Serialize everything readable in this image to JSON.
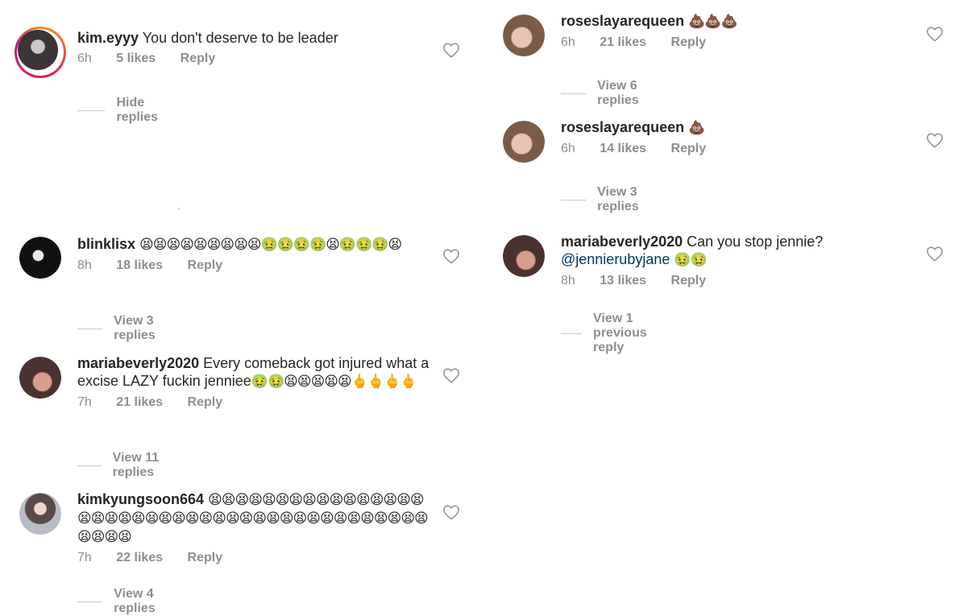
{
  "left_column": [
    {
      "username": "kim.eyyy",
      "text": "You don't deserve to be leader",
      "emojis": "",
      "time": "6h",
      "likes": "5 likes",
      "reply": "Reply",
      "replies_link": "Hide replies",
      "avatar_color": "#2e2a2c"
    },
    {
      "username": "blinklisx",
      "text": "",
      "emojis": "😫😫😫😫😫😫😫😫😫🤢🤢🤢🤢😫🤢🤢🤢😫",
      "time": "8h",
      "likes": "18 likes",
      "reply": "Reply",
      "replies_link": "View 3 replies",
      "avatar_color": "#1a1a1a"
    },
    {
      "username": "mariabeverly2020",
      "text": "Every comeback got injured what a excise LAZY fuckin jenniee",
      "emojis": "🤢🤢😫😫😫😫😫🖕🖕🖕🖕",
      "time": "7h",
      "likes": "21 likes",
      "reply": "Reply",
      "replies_link": "View 11 replies",
      "avatar_color": "#6b4a44"
    },
    {
      "username": "kimkyungsoon664",
      "text": "",
      "emojis": "😫😫😫😫😫😫😫😫😫😫😫😫😫😫😫😫😫😫😫😫😫😫😫😫😫😫😫😫😫😫😫😫😫😫😫😫😫😫😫😫😫😫😫😫😫😫",
      "time": "7h",
      "likes": "22 likes",
      "reply": "Reply",
      "replies_link": "View 4 replies",
      "avatar_color": "#8b8e96"
    }
  ],
  "right_column": [
    {
      "username": "roseslayarequeen",
      "text": "",
      "emojis": "💩💩💩",
      "time": "6h",
      "likes": "21 likes",
      "reply": "Reply",
      "replies_link": "View 6 replies",
      "avatar_color": "#c9a089"
    },
    {
      "username": "roseslayarequeen",
      "text": "",
      "emojis": "💩",
      "time": "6h",
      "likes": "14 likes",
      "reply": "Reply",
      "replies_link": "View 3 replies",
      "avatar_color": "#c9a089"
    },
    {
      "username": "mariabeverly2020",
      "text": "Can you stop jennie?",
      "mention": "@jennierubyjane",
      "emojis": "🤢🤢",
      "time": "8h",
      "likes": "13 likes",
      "reply": "Reply",
      "replies_link": "View 1 previous reply",
      "avatar_color": "#6b4a44"
    }
  ],
  "icons": {
    "like": "heart-outline-icon"
  }
}
